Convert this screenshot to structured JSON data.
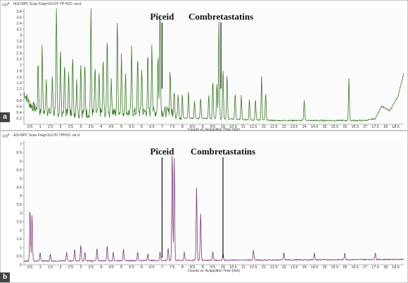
{
  "chart_data": [
    {
      "panel": "a",
      "type": "line",
      "header": "+ESI BPC Scan Frag=110.0V TP H2O -ve.d",
      "y_scale_label": "x10",
      "y_scale_exp": "6",
      "xlabel": "Counts vs. Acquisition Time (min)",
      "ylabel": "",
      "xlim": [
        0.2,
        18.9
      ],
      "ylim": [
        0,
        3.9
      ],
      "x_ticks": [
        "0.5",
        "1",
        "1.5",
        "2",
        "2.5",
        "3",
        "3.5",
        "4",
        "4.5",
        "5",
        "5.5",
        "6",
        "6.5",
        "7",
        "7.5",
        "8",
        "8.5",
        "9",
        "9.5",
        "10",
        "10.5",
        "11",
        "11.5",
        "12",
        "12.5",
        "13",
        "13.5",
        "14",
        "14.5",
        "15",
        "15.5",
        "16",
        "16.5",
        "17",
        "17.5",
        "18",
        "18.5"
      ],
      "y_ticks": [
        "0.2",
        "0.4",
        "0.6",
        "0.8",
        "1",
        "1.2",
        "1.4",
        "1.6",
        "1.8",
        "2",
        "2.2",
        "2.4",
        "2.6",
        "2.8",
        "3",
        "3.2",
        "3.4",
        "3.6",
        "3.8"
      ],
      "color": "#3b7a2a",
      "baseline": [
        [
          0.2,
          1.0
        ],
        [
          0.5,
          0.6
        ],
        [
          1.0,
          0.35
        ],
        [
          3.0,
          0.3
        ],
        [
          7.2,
          0.35
        ],
        [
          8.0,
          0.2
        ],
        [
          10.0,
          0.18
        ],
        [
          11.0,
          0.15
        ],
        [
          12.5,
          0.12
        ],
        [
          17.0,
          0.12
        ],
        [
          17.5,
          0.18
        ],
        [
          17.8,
          0.6
        ],
        [
          18.2,
          0.45
        ],
        [
          18.6,
          0.9
        ],
        [
          18.9,
          1.7
        ]
      ],
      "peaks": [
        [
          0.9,
          1.6
        ],
        [
          1.1,
          2.2
        ],
        [
          1.3,
          1.2
        ],
        [
          1.6,
          1.3
        ],
        [
          1.8,
          3.6
        ],
        [
          2.0,
          2.1
        ],
        [
          2.2,
          1.6
        ],
        [
          2.4,
          1.3
        ],
        [
          2.6,
          2.0
        ],
        [
          2.8,
          1.2
        ],
        [
          3.0,
          1.8
        ],
        [
          3.2,
          1.6
        ],
        [
          3.5,
          3.5
        ],
        [
          3.7,
          1.5
        ],
        [
          3.9,
          1.3
        ],
        [
          4.1,
          1.8
        ],
        [
          4.3,
          2.6
        ],
        [
          4.5,
          1.2
        ],
        [
          4.8,
          3.2
        ],
        [
          5.0,
          1.9
        ],
        [
          5.2,
          1.3
        ],
        [
          5.5,
          2.1
        ],
        [
          5.8,
          1.8
        ],
        [
          6.0,
          1.5
        ],
        [
          6.3,
          1.9
        ],
        [
          6.5,
          2.4
        ],
        [
          6.8,
          1.9
        ],
        [
          6.9,
          3.6
        ],
        [
          7.4,
          1.5
        ],
        [
          7.6,
          0.9
        ],
        [
          7.8,
          0.7
        ],
        [
          8.0,
          0.8
        ],
        [
          8.3,
          0.9
        ],
        [
          8.6,
          0.6
        ],
        [
          8.9,
          0.7
        ],
        [
          9.3,
          0.8
        ],
        [
          9.5,
          1.3
        ],
        [
          9.7,
          1.2
        ],
        [
          9.8,
          3.3
        ],
        [
          10.0,
          1.7
        ],
        [
          10.2,
          1.5
        ],
        [
          10.6,
          0.9
        ],
        [
          10.9,
          0.8
        ],
        [
          11.3,
          0.7
        ],
        [
          11.6,
          0.7
        ],
        [
          11.9,
          1.5
        ],
        [
          12.1,
          0.9
        ],
        [
          14.0,
          0.7
        ],
        [
          16.2,
          1.4
        ]
      ],
      "annotations": [
        {
          "label": "Piceid",
          "x": 7.0
        },
        {
          "label": "Combretastatins",
          "x": 9.9
        }
      ]
    },
    {
      "panel": "b",
      "type": "line",
      "header": "-ESI BPC Scan Frag=110.0V TPH2O -ve.d",
      "y_scale_label": "x10",
      "y_scale_exp": "5",
      "xlabel": "Counts vs. Acquisition Time (min)",
      "ylabel": "",
      "xlim": [
        0.2,
        18.9
      ],
      "ylim": [
        0,
        7.2
      ],
      "x_ticks": [
        "0.5",
        "1",
        "1.5",
        "2",
        "2.5",
        "3",
        "3.5",
        "4",
        "4.5",
        "5",
        "5.5",
        "6",
        "6.5",
        "7",
        "7.5",
        "8",
        "8.5",
        "9",
        "9.5",
        "10",
        "10.5",
        "11",
        "11.5",
        "12",
        "12.5",
        "13",
        "13.5",
        "14",
        "14.5",
        "15",
        "15.5",
        "16",
        "16.5",
        "17",
        "17.5",
        "18",
        "18.5"
      ],
      "y_ticks": [
        "0",
        "0.5",
        "1",
        "1.5",
        "2",
        "2.5",
        "3",
        "3.5",
        "4",
        "4.5",
        "5",
        "5.5",
        "6",
        "6.5",
        "7"
      ],
      "color": "#7a3a78",
      "baseline": [
        [
          0.2,
          0.2
        ],
        [
          18.9,
          0.3
        ]
      ],
      "peaks": [
        [
          0.5,
          3.1
        ],
        [
          0.6,
          2.7
        ],
        [
          1.0,
          0.5
        ],
        [
          1.5,
          0.4
        ],
        [
          2.3,
          0.5
        ],
        [
          2.7,
          0.7
        ],
        [
          3.0,
          0.9
        ],
        [
          3.2,
          0.5
        ],
        [
          3.8,
          0.7
        ],
        [
          4.3,
          0.9
        ],
        [
          4.6,
          0.5
        ],
        [
          5.1,
          0.7
        ],
        [
          5.8,
          0.5
        ],
        [
          6.3,
          0.4
        ],
        [
          6.9,
          0.5
        ],
        [
          7.3,
          0.7
        ],
        [
          7.5,
          6.4
        ],
        [
          7.6,
          6.0
        ],
        [
          8.1,
          0.5
        ],
        [
          8.7,
          4.2
        ],
        [
          8.9,
          2.8
        ],
        [
          9.5,
          0.5
        ],
        [
          10.0,
          0.4
        ],
        [
          11.5,
          0.6
        ],
        [
          13.0,
          0.4
        ],
        [
          14.5,
          0.4
        ],
        [
          16.0,
          0.4
        ],
        [
          17.5,
          0.4
        ]
      ],
      "annotations": [
        {
          "label": "Piceid",
          "x": 7.0
        },
        {
          "label": "Combretastatins",
          "x": 10.0
        }
      ]
    }
  ]
}
